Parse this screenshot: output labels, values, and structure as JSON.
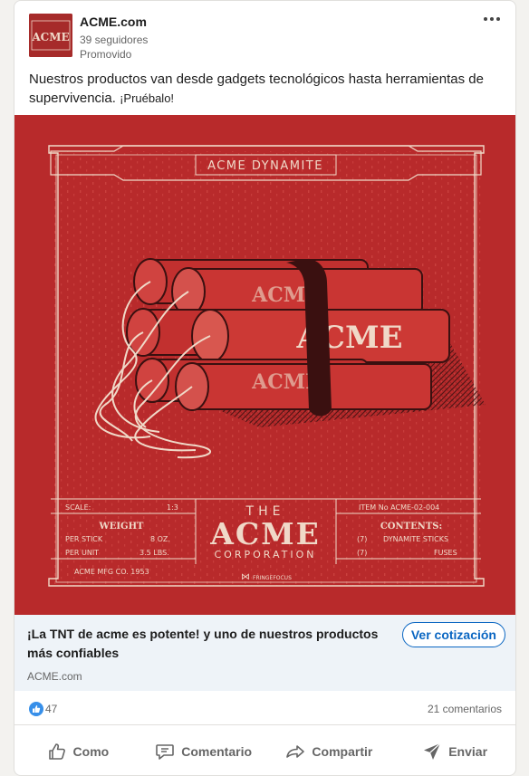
{
  "post": {
    "company_name": "ACME.com",
    "followers": "39 seguidores",
    "promoted": "Promovido",
    "text_main": "Nuestros productos van desde gadgets tecnológicos hasta herramientas de supervivencia.",
    "text_small": "¡Pruébalo!"
  },
  "avatar": {
    "text": "ACME"
  },
  "poster": {
    "banner": "ACME DYNAMITE",
    "scale_label": "SCALE:",
    "scale_value": "1:3",
    "weight_title": "WEIGHT",
    "per_stick_label": "PER STICK",
    "per_stick_value": "8 OZ.",
    "per_unit_label": "PER UNIT",
    "per_unit_value": "3.5 LBS.",
    "mfg": "ACME MFG CO. 1953",
    "the": "THE",
    "acme": "ACME",
    "corporation": "CORPORATION",
    "item_no": "ITEM No ACME-02-004",
    "contents_title": "CONTENTS:",
    "contents_1_qty": "(7)",
    "contents_1_label": "DYNAMITE STICKS",
    "contents_2_qty": "(7)",
    "contents_2_label": "FUSES",
    "signature": "FRINGEFOCUS",
    "stick_text": "ACME"
  },
  "link": {
    "title": "¡La TNT de acme es potente! y uno de nuestros productos más confiables",
    "domain": "ACME.com",
    "cta": "Ver cotización"
  },
  "social": {
    "reactions": "47",
    "comments": "21 comentarios"
  },
  "actions": {
    "like": "Como",
    "comment": "Comentario",
    "share": "Compartir",
    "send": "Enviar"
  },
  "colors": {
    "poster_red": "#b82a2b",
    "poster_cream": "#f0d9c8",
    "link_blue": "#0a66c2",
    "link_bar_bg": "#eef3f8"
  }
}
